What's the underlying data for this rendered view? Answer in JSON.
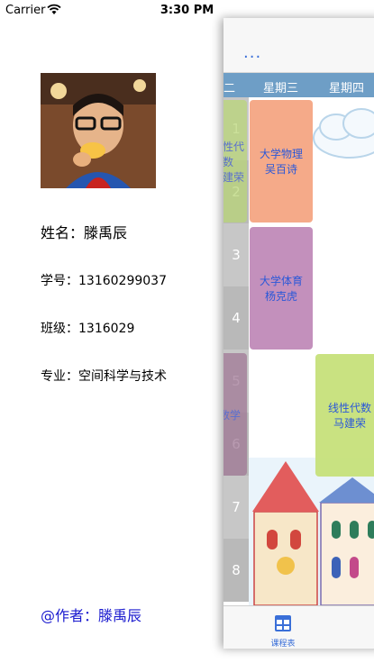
{
  "status_bar": {
    "carrier": "Carrier",
    "time": "3:30 PM"
  },
  "profile": {
    "name_line": "姓名：滕禹辰",
    "student_id_line": "学号：13160299037",
    "class_line": "班级：1316029",
    "major_line": "专业：空间科学与技术",
    "author_line": "@作者：滕禹辰"
  },
  "main": {
    "more_label": "...",
    "week_days": [
      "二",
      "星期三",
      "星期四"
    ],
    "row_numbers": [
      "1",
      "2",
      "3",
      "4",
      "5",
      "6",
      "7",
      "8"
    ],
    "courses": [
      {
        "name": "大学物理",
        "teacher": "吴百诗"
      },
      {
        "name": "大学体育",
        "teacher": "杨克虎"
      },
      {
        "name": "线性代数",
        "teacher": "马建荣"
      }
    ],
    "partial_course_1": {
      "name": "线性代数",
      "teacher": "马建荣"
    },
    "partial_course_2": {
      "name": "数学",
      "teacher": ""
    },
    "tab_label": "课程表",
    "colors": {
      "accent": "#3a6fd8",
      "week_header": "#6e9ec6",
      "physics": "#f4a37f",
      "pe": "#c08ab8",
      "linear_algebra": "#c6e07a",
      "author_link": "#1a1acf"
    }
  }
}
